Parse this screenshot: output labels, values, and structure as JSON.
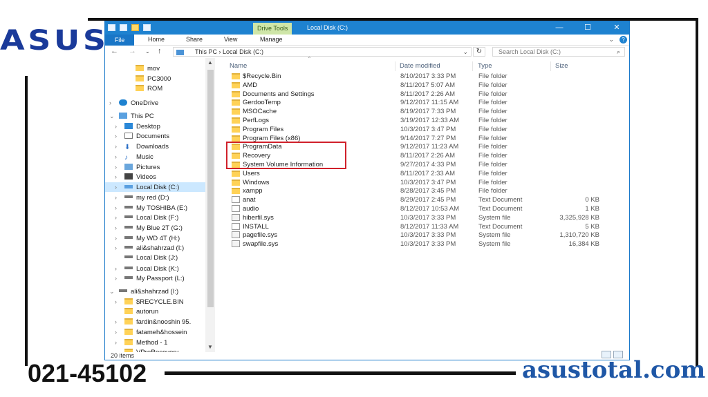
{
  "branding": {
    "logo": "ASUS",
    "phone": "021-45102",
    "site": "asustotal.com"
  },
  "window": {
    "context_tab": "Drive Tools",
    "title": "Local Disk (C:)",
    "minimize": "—",
    "maximize": "☐",
    "close": "✕"
  },
  "ribbon": {
    "tabs": [
      "File",
      "Home",
      "Share",
      "View",
      "Manage"
    ]
  },
  "address": {
    "path_root": "This PC",
    "path_sep": "›",
    "path_leaf": "Local Disk (C:)",
    "search_placeholder": "Search Local Disk (C:)"
  },
  "columns": {
    "name": "Name",
    "date": "Date modified",
    "type": "Type",
    "size": "Size"
  },
  "nav": [
    {
      "label": "mov",
      "icon": "folder-icon",
      "chev": ""
    },
    {
      "label": "PC3000",
      "icon": "folder-icon",
      "chev": ""
    },
    {
      "label": "ROM",
      "icon": "folder-icon",
      "chev": ""
    },
    {
      "label": "OneDrive",
      "icon": "cloud-icon",
      "chev": ">"
    },
    {
      "label": "This PC",
      "icon": "pc-icon",
      "chev": "v"
    },
    {
      "label": "Desktop",
      "icon": "desktop-icon",
      "chev": ">"
    },
    {
      "label": "Documents",
      "icon": "documents-icon",
      "chev": ">"
    },
    {
      "label": "Downloads",
      "icon": "downloads-icon",
      "chev": ">"
    },
    {
      "label": "Music",
      "icon": "music-icon",
      "chev": ">"
    },
    {
      "label": "Pictures",
      "icon": "pictures-icon",
      "chev": ">"
    },
    {
      "label": "Videos",
      "icon": "videos-icon",
      "chev": ">"
    },
    {
      "label": "Local Disk (C:)",
      "icon": "drive-c-icon",
      "chev": ">"
    },
    {
      "label": "my red (D:)",
      "icon": "drive-icon",
      "chev": ">"
    },
    {
      "label": "My TOSHIBA (E:)",
      "icon": "drive-icon",
      "chev": ">"
    },
    {
      "label": "Local Disk (F:)",
      "icon": "drive-icon",
      "chev": ">"
    },
    {
      "label": "My Blue 2T (G:)",
      "icon": "drive-icon",
      "chev": ">"
    },
    {
      "label": "My WD 4T (H:)",
      "icon": "drive-icon",
      "chev": ">"
    },
    {
      "label": "ali&shahrzad (I:)",
      "icon": "drive-icon",
      "chev": ">"
    },
    {
      "label": "Local Disk (J:)",
      "icon": "drive-icon",
      "chev": ""
    },
    {
      "label": "Local Disk (K:)",
      "icon": "drive-icon",
      "chev": ">"
    },
    {
      "label": "My Passport (L:)",
      "icon": "drive-icon",
      "chev": ">"
    },
    {
      "label": "ali&shahrzad (I:)",
      "icon": "drive-icon",
      "chev": "v"
    },
    {
      "label": "$RECYCLE.BIN",
      "icon": "folder-icon",
      "chev": ">"
    },
    {
      "label": "autorun",
      "icon": "folder-icon",
      "chev": ""
    },
    {
      "label": "fardin&nooshin  95.",
      "icon": "folder-icon",
      "chev": ">"
    },
    {
      "label": "fatameh&hossein",
      "icon": "folder-icon",
      "chev": ">"
    },
    {
      "label": "Method - 1",
      "icon": "folder-icon",
      "chev": ">"
    },
    {
      "label": "VProRecovery",
      "icon": "folder-icon",
      "chev": ""
    }
  ],
  "files": [
    {
      "name": "$Recycle.Bin",
      "date": "8/10/2017 3:33 PM",
      "type": "File folder",
      "size": "",
      "kind": "folder"
    },
    {
      "name": "AMD",
      "date": "8/11/2017 5:07 AM",
      "type": "File folder",
      "size": "",
      "kind": "folder"
    },
    {
      "name": "Documents and Settings",
      "date": "8/11/2017 2:26 AM",
      "type": "File folder",
      "size": "",
      "kind": "folder"
    },
    {
      "name": "GerdooTemp",
      "date": "9/12/2017 11:15 AM",
      "type": "File folder",
      "size": "",
      "kind": "folder"
    },
    {
      "name": "MSOCache",
      "date": "8/19/2017 7:33 PM",
      "type": "File folder",
      "size": "",
      "kind": "folder"
    },
    {
      "name": "PerfLogs",
      "date": "3/19/2017 12:33 AM",
      "type": "File folder",
      "size": "",
      "kind": "folder"
    },
    {
      "name": "Program Files",
      "date": "10/3/2017 3:47 PM",
      "type": "File folder",
      "size": "",
      "kind": "folder"
    },
    {
      "name": "Program Files (x86)",
      "date": "9/14/2017 7:27 PM",
      "type": "File folder",
      "size": "",
      "kind": "folder"
    },
    {
      "name": "ProgramData",
      "date": "9/12/2017 11:23 AM",
      "type": "File folder",
      "size": "",
      "kind": "folder"
    },
    {
      "name": "Recovery",
      "date": "8/11/2017 2:26 AM",
      "type": "File folder",
      "size": "",
      "kind": "folder"
    },
    {
      "name": "System Volume Information",
      "date": "9/27/2017 4:33 PM",
      "type": "File folder",
      "size": "",
      "kind": "folder"
    },
    {
      "name": "Users",
      "date": "8/11/2017 2:33 AM",
      "type": "File folder",
      "size": "",
      "kind": "folder"
    },
    {
      "name": "Windows",
      "date": "10/3/2017 3:47 PM",
      "type": "File folder",
      "size": "",
      "kind": "folder"
    },
    {
      "name": "xampp",
      "date": "8/28/2017 3:45 PM",
      "type": "File folder",
      "size": "",
      "kind": "folder"
    },
    {
      "name": "anat",
      "date": "8/29/2017 2:45 PM",
      "type": "Text Document",
      "size": "0 KB",
      "kind": "file"
    },
    {
      "name": "audio",
      "date": "8/12/2017 10:53 AM",
      "type": "Text Document",
      "size": "1 KB",
      "kind": "file"
    },
    {
      "name": "hiberfil.sys",
      "date": "10/3/2017 3:33 PM",
      "type": "System file",
      "size": "3,325,928 KB",
      "kind": "sys"
    },
    {
      "name": "INSTALL",
      "date": "8/12/2017 11:33 AM",
      "type": "Text Document",
      "size": "5 KB",
      "kind": "file"
    },
    {
      "name": "pagefile.sys",
      "date": "10/3/2017 3:33 PM",
      "type": "System file",
      "size": "1,310,720 KB",
      "kind": "sys"
    },
    {
      "name": "swapfile.sys",
      "date": "10/3/2017 3:33 PM",
      "type": "System file",
      "size": "16,384 KB",
      "kind": "sys"
    }
  ],
  "status": {
    "items": "20 items"
  }
}
